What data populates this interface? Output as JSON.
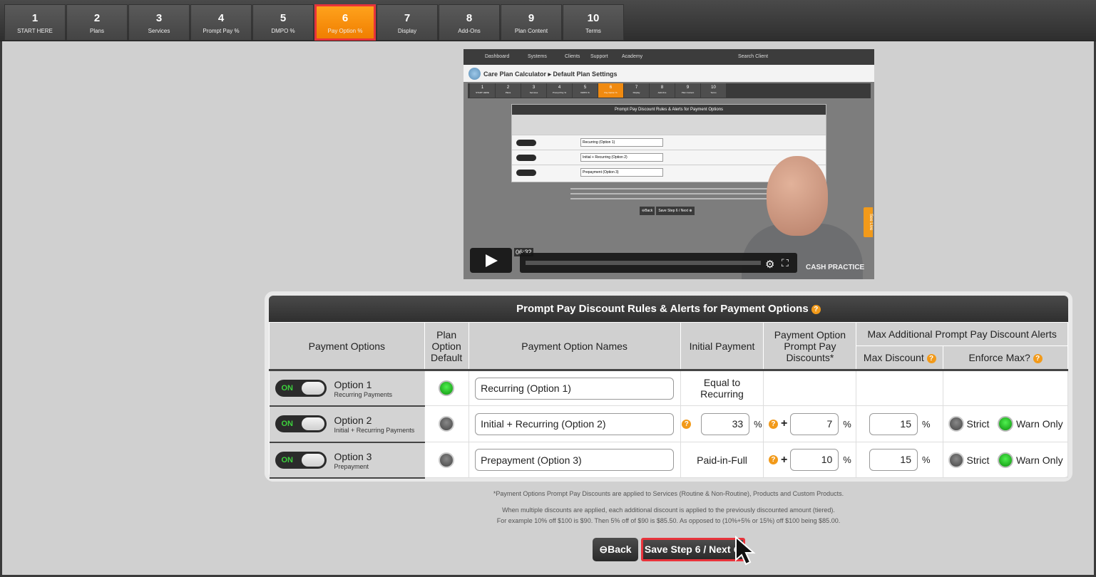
{
  "steps": [
    {
      "num": "1",
      "label": "START HERE"
    },
    {
      "num": "2",
      "label": "Plans"
    },
    {
      "num": "3",
      "label": "Services"
    },
    {
      "num": "4",
      "label": "Prompt Pay %"
    },
    {
      "num": "5",
      "label": "DMPO %"
    },
    {
      "num": "6",
      "label": "Pay Option %",
      "active": true
    },
    {
      "num": "7",
      "label": "Display"
    },
    {
      "num": "8",
      "label": "Add-Ons"
    },
    {
      "num": "9",
      "label": "Plan Content"
    },
    {
      "num": "10",
      "label": "Terms"
    }
  ],
  "video": {
    "nav_items": [
      "Dashboard",
      "Systems",
      "Clients",
      "Support",
      "Academy"
    ],
    "search": "Search Client",
    "breadcrumb": "Care Plan Calculator ▸ Default Plan Settings",
    "duration": "06:32",
    "see_live": "See Live",
    "brand": "CASH PRACTICE"
  },
  "card": {
    "title": "Prompt Pay Discount Rules & Alerts for Payment Options",
    "help_glyph": "?",
    "headers": {
      "payment_options": "Payment Options",
      "plan_option_default": "Plan Option Default",
      "option_names": "Payment Option Names",
      "initial_payment": "Initial Payment",
      "prompt_pay": "Payment Option Prompt Pay Discounts*",
      "alerts": "Max Additional Prompt Pay Discount Alerts",
      "max_discount": "Max Discount",
      "enforce_max": "Enforce Max?"
    },
    "toggle_on": "ON",
    "rows": [
      {
        "title": "Option 1",
        "subtitle": "Recurring Payments",
        "name": "Recurring (Option 1)",
        "initial_text": "Equal to Recurring",
        "default": true
      },
      {
        "title": "Option 2",
        "subtitle": "Initial + Recurring Payments",
        "name": "Initial + Recurring (Option 2)",
        "initial_value": "33",
        "discount": "7",
        "max": "15",
        "default": false
      },
      {
        "title": "Option 3",
        "subtitle": "Prepayment",
        "name": "Prepayment (Option 3)",
        "initial_text": "Paid-in-Full",
        "discount": "10",
        "max": "15",
        "default": false
      }
    ],
    "pct": "%",
    "plus": "+",
    "strict": "Strict",
    "warn_only": "Warn Only"
  },
  "notes": {
    "line1": "*Payment Options Prompt Pay Discounts are applied to Services (Routine & Non-Routine), Products and Custom Products.",
    "line2": "When multiple discounts are applied, each additional discount is applied to the previously discounted amount (tiered).",
    "line3": "For example 10% off $100 is $90. Then 5% off of $90 is $85.50. As opposed to (10%+5% or 15%) off $100 being $85.00."
  },
  "buttons": {
    "back": "⊖Back",
    "next": "Save Step 6 / Next ⊕"
  }
}
